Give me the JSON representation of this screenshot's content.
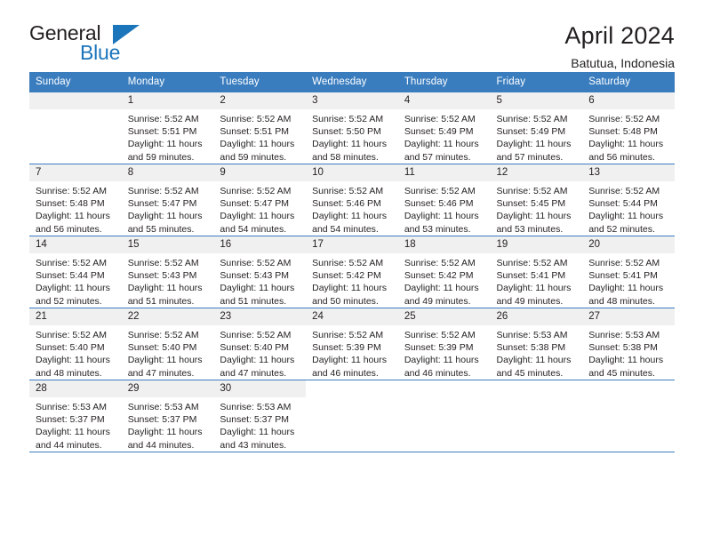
{
  "brand": {
    "name_part1": "General",
    "name_part2": "Blue",
    "accent_color": "#1b75bb",
    "logo_icon": "triangle-icon"
  },
  "header": {
    "title": "April 2024",
    "location": "Batutua, Indonesia"
  },
  "calendar": {
    "header_bg": "#3a7dbf",
    "daynum_bg": "#f0f0f0",
    "weekdays": [
      "Sunday",
      "Monday",
      "Tuesday",
      "Wednesday",
      "Thursday",
      "Friday",
      "Saturday"
    ],
    "labels": {
      "sunrise": "Sunrise:",
      "sunset": "Sunset:",
      "daylight": "Daylight:"
    },
    "weeks": [
      [
        {
          "day": "",
          "empty": true
        },
        {
          "day": "1",
          "sunrise": "Sunrise: 5:52 AM",
          "sunset": "Sunset: 5:51 PM",
          "daylight": "Daylight: 11 hours and 59 minutes."
        },
        {
          "day": "2",
          "sunrise": "Sunrise: 5:52 AM",
          "sunset": "Sunset: 5:51 PM",
          "daylight": "Daylight: 11 hours and 59 minutes."
        },
        {
          "day": "3",
          "sunrise": "Sunrise: 5:52 AM",
          "sunset": "Sunset: 5:50 PM",
          "daylight": "Daylight: 11 hours and 58 minutes."
        },
        {
          "day": "4",
          "sunrise": "Sunrise: 5:52 AM",
          "sunset": "Sunset: 5:49 PM",
          "daylight": "Daylight: 11 hours and 57 minutes."
        },
        {
          "day": "5",
          "sunrise": "Sunrise: 5:52 AM",
          "sunset": "Sunset: 5:49 PM",
          "daylight": "Daylight: 11 hours and 57 minutes."
        },
        {
          "day": "6",
          "sunrise": "Sunrise: 5:52 AM",
          "sunset": "Sunset: 5:48 PM",
          "daylight": "Daylight: 11 hours and 56 minutes."
        }
      ],
      [
        {
          "day": "7",
          "sunrise": "Sunrise: 5:52 AM",
          "sunset": "Sunset: 5:48 PM",
          "daylight": "Daylight: 11 hours and 56 minutes."
        },
        {
          "day": "8",
          "sunrise": "Sunrise: 5:52 AM",
          "sunset": "Sunset: 5:47 PM",
          "daylight": "Daylight: 11 hours and 55 minutes."
        },
        {
          "day": "9",
          "sunrise": "Sunrise: 5:52 AM",
          "sunset": "Sunset: 5:47 PM",
          "daylight": "Daylight: 11 hours and 54 minutes."
        },
        {
          "day": "10",
          "sunrise": "Sunrise: 5:52 AM",
          "sunset": "Sunset: 5:46 PM",
          "daylight": "Daylight: 11 hours and 54 minutes."
        },
        {
          "day": "11",
          "sunrise": "Sunrise: 5:52 AM",
          "sunset": "Sunset: 5:46 PM",
          "daylight": "Daylight: 11 hours and 53 minutes."
        },
        {
          "day": "12",
          "sunrise": "Sunrise: 5:52 AM",
          "sunset": "Sunset: 5:45 PM",
          "daylight": "Daylight: 11 hours and 53 minutes."
        },
        {
          "day": "13",
          "sunrise": "Sunrise: 5:52 AM",
          "sunset": "Sunset: 5:44 PM",
          "daylight": "Daylight: 11 hours and 52 minutes."
        }
      ],
      [
        {
          "day": "14",
          "sunrise": "Sunrise: 5:52 AM",
          "sunset": "Sunset: 5:44 PM",
          "daylight": "Daylight: 11 hours and 52 minutes."
        },
        {
          "day": "15",
          "sunrise": "Sunrise: 5:52 AM",
          "sunset": "Sunset: 5:43 PM",
          "daylight": "Daylight: 11 hours and 51 minutes."
        },
        {
          "day": "16",
          "sunrise": "Sunrise: 5:52 AM",
          "sunset": "Sunset: 5:43 PM",
          "daylight": "Daylight: 11 hours and 51 minutes."
        },
        {
          "day": "17",
          "sunrise": "Sunrise: 5:52 AM",
          "sunset": "Sunset: 5:42 PM",
          "daylight": "Daylight: 11 hours and 50 minutes."
        },
        {
          "day": "18",
          "sunrise": "Sunrise: 5:52 AM",
          "sunset": "Sunset: 5:42 PM",
          "daylight": "Daylight: 11 hours and 49 minutes."
        },
        {
          "day": "19",
          "sunrise": "Sunrise: 5:52 AM",
          "sunset": "Sunset: 5:41 PM",
          "daylight": "Daylight: 11 hours and 49 minutes."
        },
        {
          "day": "20",
          "sunrise": "Sunrise: 5:52 AM",
          "sunset": "Sunset: 5:41 PM",
          "daylight": "Daylight: 11 hours and 48 minutes."
        }
      ],
      [
        {
          "day": "21",
          "sunrise": "Sunrise: 5:52 AM",
          "sunset": "Sunset: 5:40 PM",
          "daylight": "Daylight: 11 hours and 48 minutes."
        },
        {
          "day": "22",
          "sunrise": "Sunrise: 5:52 AM",
          "sunset": "Sunset: 5:40 PM",
          "daylight": "Daylight: 11 hours and 47 minutes."
        },
        {
          "day": "23",
          "sunrise": "Sunrise: 5:52 AM",
          "sunset": "Sunset: 5:40 PM",
          "daylight": "Daylight: 11 hours and 47 minutes."
        },
        {
          "day": "24",
          "sunrise": "Sunrise: 5:52 AM",
          "sunset": "Sunset: 5:39 PM",
          "daylight": "Daylight: 11 hours and 46 minutes."
        },
        {
          "day": "25",
          "sunrise": "Sunrise: 5:52 AM",
          "sunset": "Sunset: 5:39 PM",
          "daylight": "Daylight: 11 hours and 46 minutes."
        },
        {
          "day": "26",
          "sunrise": "Sunrise: 5:53 AM",
          "sunset": "Sunset: 5:38 PM",
          "daylight": "Daylight: 11 hours and 45 minutes."
        },
        {
          "day": "27",
          "sunrise": "Sunrise: 5:53 AM",
          "sunset": "Sunset: 5:38 PM",
          "daylight": "Daylight: 11 hours and 45 minutes."
        }
      ],
      [
        {
          "day": "28",
          "sunrise": "Sunrise: 5:53 AM",
          "sunset": "Sunset: 5:37 PM",
          "daylight": "Daylight: 11 hours and 44 minutes."
        },
        {
          "day": "29",
          "sunrise": "Sunrise: 5:53 AM",
          "sunset": "Sunset: 5:37 PM",
          "daylight": "Daylight: 11 hours and 44 minutes."
        },
        {
          "day": "30",
          "sunrise": "Sunrise: 5:53 AM",
          "sunset": "Sunset: 5:37 PM",
          "daylight": "Daylight: 11 hours and 43 minutes."
        },
        {
          "day": "",
          "blank": true
        },
        {
          "day": "",
          "blank": true
        },
        {
          "day": "",
          "blank": true
        },
        {
          "day": "",
          "blank": true
        }
      ]
    ]
  }
}
